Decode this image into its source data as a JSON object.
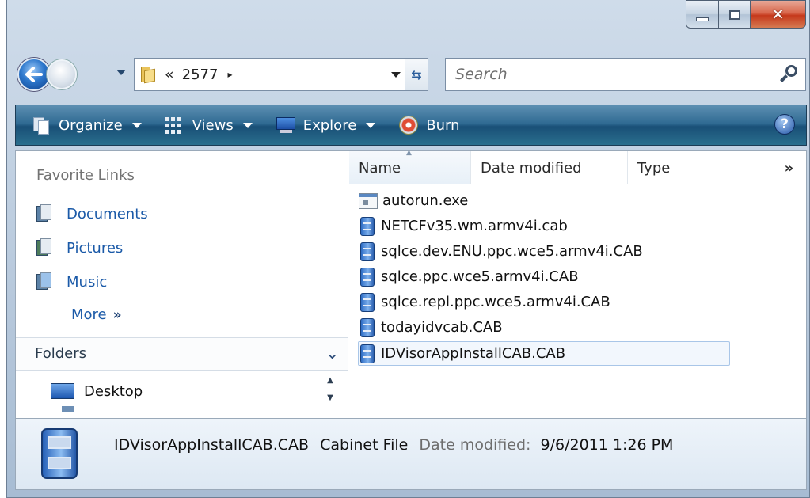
{
  "address": {
    "chevron": "«",
    "path": "2577",
    "arrow": "▸"
  },
  "search": {
    "placeholder": "Search"
  },
  "toolbar": {
    "organize": "Organize",
    "views": "Views",
    "explore": "Explore",
    "burn": "Burn",
    "help": "?"
  },
  "nav": {
    "favorite_links_title": "Favorite Links",
    "links": [
      {
        "label": "Documents",
        "icon": "documents-icon"
      },
      {
        "label": "Pictures",
        "icon": "pictures-icon"
      },
      {
        "label": "Music",
        "icon": "music-icon"
      }
    ],
    "more": "More",
    "more_glyph": "»",
    "folders_title": "Folders",
    "folders_chevron": "⌄",
    "tree": [
      {
        "label": "Desktop",
        "icon": "desktop-icon"
      }
    ]
  },
  "columns": {
    "name": "Name",
    "date_modified": "Date modified",
    "type": "Type",
    "more": "»"
  },
  "files": [
    {
      "name": "autorun.exe",
      "icon": "exe-icon"
    },
    {
      "name": "NETCFv35.wm.armv4i.cab",
      "icon": "cab-icon"
    },
    {
      "name": "sqlce.dev.ENU.ppc.wce5.armv4i.CAB",
      "icon": "cab-icon"
    },
    {
      "name": "sqlce.ppc.wce5.armv4i.CAB",
      "icon": "cab-icon"
    },
    {
      "name": "sqlce.repl.ppc.wce5.armv4i.CAB",
      "icon": "cab-icon"
    },
    {
      "name": "todayidvcab.CAB",
      "icon": "cab-icon"
    },
    {
      "name": "IDVisorAppInstallCAB.CAB",
      "icon": "cab-icon",
      "selected": true
    }
  ],
  "details": {
    "name": "IDVisorAppInstallCAB.CAB",
    "type": "Cabinet File",
    "date_label": "Date modified:",
    "date_value": "9/6/2011 1:26 PM"
  },
  "colors": {
    "toolbar": "#2f6a92",
    "link": "#1b5aa8",
    "selection_border": "#a9c6e8",
    "close_button": "#c5381b"
  }
}
